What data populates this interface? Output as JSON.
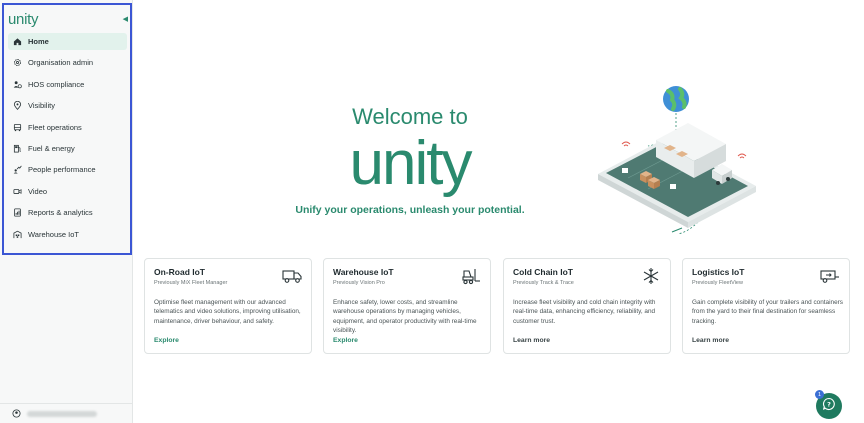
{
  "brand": {
    "logo": "unity"
  },
  "sidebar": {
    "items": [
      {
        "label": "Home",
        "icon": "home-icon",
        "active": true
      },
      {
        "label": "Organisation admin",
        "icon": "gear-icon"
      },
      {
        "label": "HOS compliance",
        "icon": "driver-clock-icon"
      },
      {
        "label": "Visibility",
        "icon": "location-pin-icon"
      },
      {
        "label": "Fleet operations",
        "icon": "vehicle-icon"
      },
      {
        "label": "Fuel & energy",
        "icon": "fuel-pump-icon"
      },
      {
        "label": "People performance",
        "icon": "performance-icon"
      },
      {
        "label": "Video",
        "icon": "video-camera-icon"
      },
      {
        "label": "Reports & analytics",
        "icon": "report-icon"
      },
      {
        "label": "Warehouse IoT",
        "icon": "warehouse-icon"
      }
    ]
  },
  "hero": {
    "welcome": "Welcome to",
    "wordmark": "unity",
    "tagline": "Unify your operations, unleash your potential."
  },
  "cards": [
    {
      "title": "On-Road IoT",
      "subtitle": "Previously MiX Fleet Manager",
      "description": "Optimise fleet management with our advanced telematics and video solutions, improving utilisation, maintenance, driver behaviour, and safety.",
      "link": "Explore",
      "icon": "truck-icon"
    },
    {
      "title": "Warehouse IoT",
      "subtitle": "Previously Vision Pro",
      "description": "Enhance safety, lower costs, and streamline warehouse operations by managing vehicles, equipment, and operator productivity with real-time visibility.",
      "link": "Explore",
      "icon": "forklift-icon"
    },
    {
      "title": "Cold Chain IoT",
      "subtitle": "Previously Track & Trace",
      "description": "Increase fleet visibility and cold chain integrity with real-time data, enhancing efficiency, reliability, and customer trust.",
      "link": "Learn more",
      "icon": "snowflake-icon"
    },
    {
      "title": "Logistics IoT",
      "subtitle": "Previously FleetView",
      "description": "Gain complete visibility of your trailers and containers from the yard to their final destination for seamless tracking.",
      "link": "Learn more",
      "icon": "trailer-icon"
    }
  ],
  "help": {
    "badge": "1",
    "icon": "chat-help-icon"
  },
  "colors": {
    "brand": "#2a8a6e",
    "active_bg": "#e2f2ec",
    "highlight": "#3b56d4",
    "fab": "#1f7a5f"
  }
}
